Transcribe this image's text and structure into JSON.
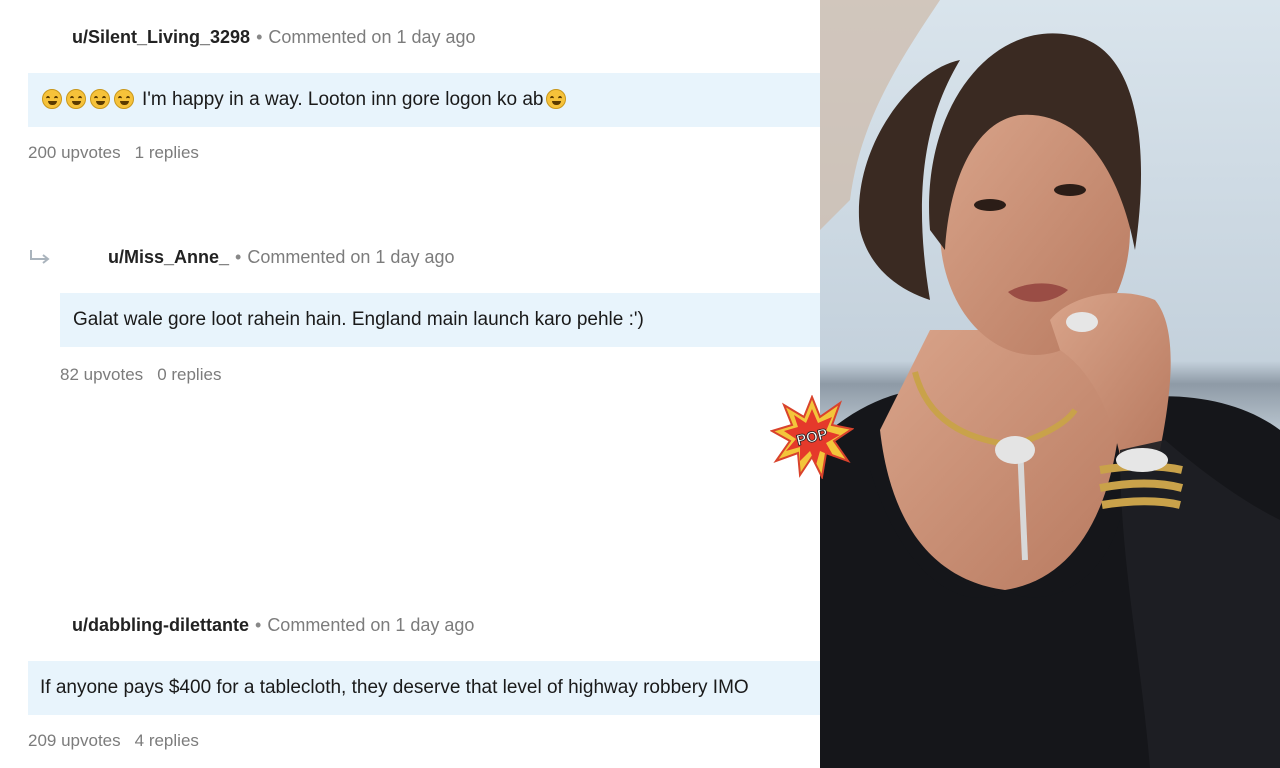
{
  "comments": [
    {
      "username": "u/Silent_Living_3298",
      "meta": "Commented on 1 day ago",
      "text": "I'm happy in a way. Looton inn gore logon ko ab",
      "upvotes": "200 upvotes",
      "replies": "1 replies"
    },
    {
      "username": "u/Miss_Anne_",
      "meta": "Commented on 1 day ago",
      "text": "Galat wale gore loot rahein hain. England main launch karo pehle :')",
      "upvotes": "82 upvotes",
      "replies": "0 replies"
    },
    {
      "username": "u/dabbling-dilettante",
      "meta": "Commented on 1 day ago",
      "text": "If anyone pays $400 for a tablecloth, they deserve that level of highway robbery IMO",
      "upvotes": "209 upvotes",
      "replies": "4 replies"
    }
  ],
  "badge": {
    "logo_text": "POP"
  },
  "colors": {
    "bubble": "#e8f4fc",
    "meta": "#7c7c7c",
    "username": "#222222",
    "dress": "#15161a",
    "gold": "#c9a24a"
  },
  "icons": {
    "reply": "reply-arrow-icon",
    "emoji": "rolling-laughing-emoji"
  }
}
